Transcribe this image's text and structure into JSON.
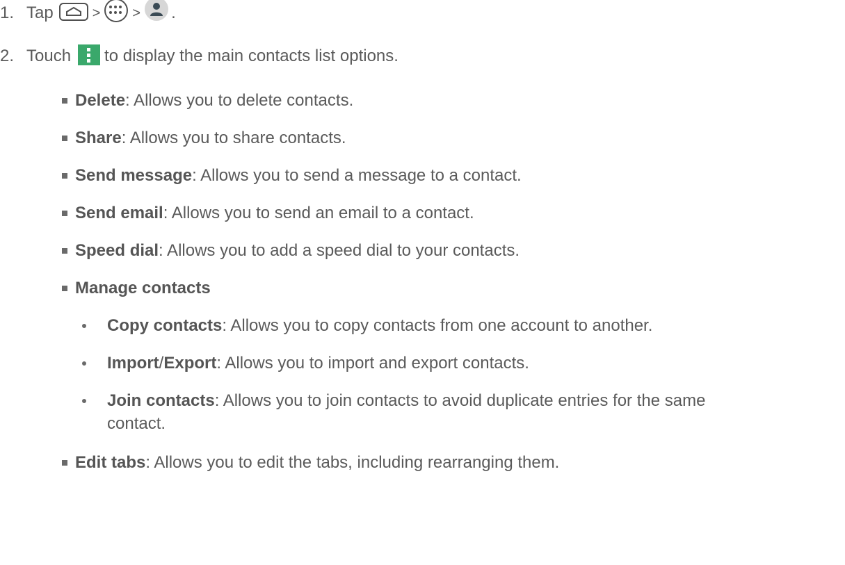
{
  "steps": [
    {
      "number": "1.",
      "text_before": "Tap",
      "sep1": ">",
      "sep2": ">",
      "end": ".",
      "icons": [
        "home-icon",
        "apps-icon",
        "contacts-icon"
      ]
    },
    {
      "number": "2.",
      "text_before": "Touch",
      "text_after": "to display the main contacts list options.",
      "icons": [
        "menu-icon"
      ]
    }
  ],
  "options": [
    {
      "term": "Delete",
      "desc": ": Allows you to delete contacts."
    },
    {
      "term": "Share",
      "desc": ": Allows you to share contacts."
    },
    {
      "term": "Send message",
      "desc": ": Allows you to send a message to a contact."
    },
    {
      "term": "Send email",
      "desc": ": Allows you to send an email to a contact."
    },
    {
      "term": "Speed dial",
      "desc": ": Allows you to add a speed dial to your contacts."
    },
    {
      "term": "Manage contacts",
      "desc": ""
    }
  ],
  "manage_contacts": [
    {
      "term": "Copy contacts",
      "desc": ": Allows you to copy contacts from one account to another."
    },
    {
      "term_a": "Import",
      "slash": "/",
      "term_b": "Export",
      "desc": ": Allows you to import and export contacts."
    },
    {
      "term": "Join contacts",
      "desc": ": Allows you to join contacts to avoid duplicate entries for the same",
      "desc_line2": "contact."
    }
  ],
  "last_option": {
    "term": "Edit tabs",
    "desc": ": Allows you to edit the tabs, including rearranging them."
  },
  "colors": {
    "text": "#5a5a5a",
    "menu_icon_bg": "#3aa86b",
    "contacts_icon_bg": "#d7d7d7"
  }
}
